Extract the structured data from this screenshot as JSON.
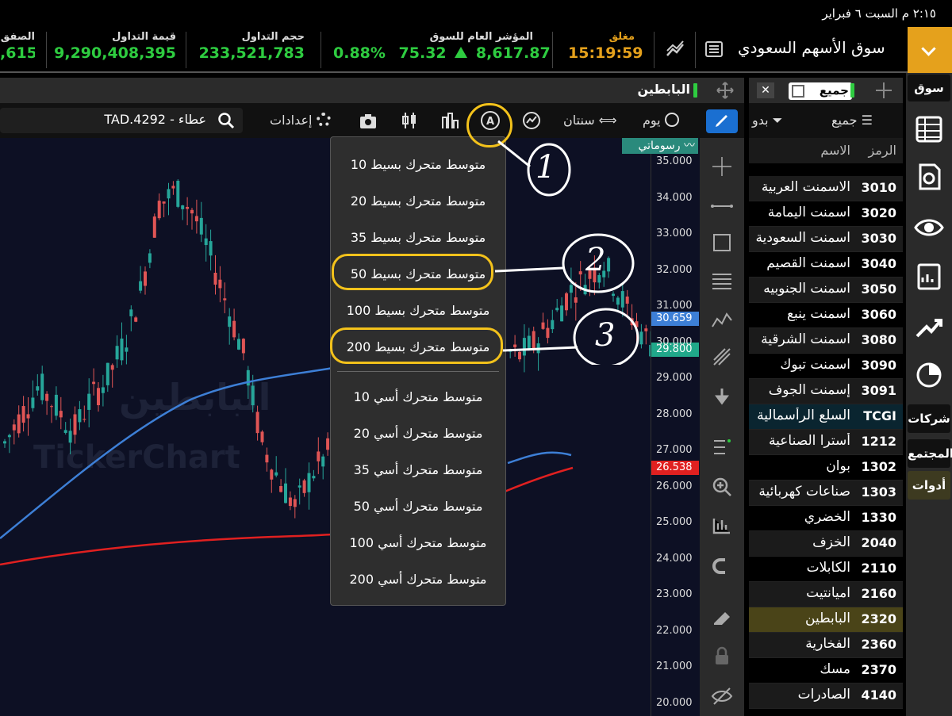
{
  "status_bar": {
    "datetime": "٢:١٥ م   السبت ٦ فبراير"
  },
  "market": {
    "title": "سوق الأسهم السعودي",
    "status_label": "مغلق",
    "status_time": "15:19:59",
    "index_label": "المؤشر العام للسوق",
    "index_value": "8,617.87",
    "index_change": "75.32",
    "index_pct": "0.88%",
    "volume_label": "حجم التداول",
    "volume_value": "233,521,783",
    "turnover_label": "قيمة التداول",
    "turnover_value": "9,290,408,395",
    "deals_label": "الصفق",
    "deals_value": ",615"
  },
  "chart": {
    "title": "البابطين",
    "symbol_search": "TAD.4292 - عطاء",
    "settings_label": "إعدادات",
    "period_label": "سنتان",
    "interval_label": "يوم",
    "drawings_label": "رسوماتي",
    "watermark": "البابطين",
    "watermark2": "TickerChart",
    "price_ticks": [
      "35.000",
      "34.000",
      "33.000",
      "32.000",
      "31.000",
      "30.000",
      "29.000",
      "28.000",
      "27.000",
      "26.000",
      "25.000",
      "24.000",
      "23.000",
      "22.000",
      "21.000",
      "20.000"
    ],
    "tag_ma_blue": "30.659",
    "tag_last": "29.800",
    "tag_ma_red": "26.538"
  },
  "indicator_menu": {
    "items": [
      "متوسط متحرك بسيط 10",
      "متوسط متحرك بسيط 20",
      "متوسط متحرك بسيط 35",
      "متوسط متحرك بسيط 50",
      "متوسط متحرك بسيط 100",
      "متوسط متحرك بسيط 200",
      "متوسط متحرك أسي 10",
      "متوسط متحرك أسي 20",
      "متوسط متحرك أسي 35",
      "متوسط متحرك أسي 50",
      "متوسط متحرك أسي 100",
      "متوسط متحرك أسي 200"
    ]
  },
  "annotations": {
    "one": "1",
    "two": "2",
    "three": "3"
  },
  "watchlist": {
    "title": "جميع",
    "filter_all": "جميع",
    "filter_none": "بدو",
    "col_symbol": "الرمز",
    "col_name": "الاسم",
    "rows": [
      {
        "sym": "3010",
        "name": "الاسمنت العربية"
      },
      {
        "sym": "3020",
        "name": "اسمنت اليمامة"
      },
      {
        "sym": "3030",
        "name": "اسمنت السعودية"
      },
      {
        "sym": "3040",
        "name": "اسمنت القصيم"
      },
      {
        "sym": "3050",
        "name": "اسمنت الجنوبيه"
      },
      {
        "sym": "3060",
        "name": "اسمنت ينبع"
      },
      {
        "sym": "3080",
        "name": "اسمنت الشرقية"
      },
      {
        "sym": "3090",
        "name": "اسمنت تبوك"
      },
      {
        "sym": "3091",
        "name": "إسمنت الجوف"
      },
      {
        "sym": "TCGI",
        "name": "السلع الرأسمالية"
      },
      {
        "sym": "1212",
        "name": "أسترا الصناعية"
      },
      {
        "sym": "1302",
        "name": "بوان"
      },
      {
        "sym": "1303",
        "name": "صناعات كهربائية"
      },
      {
        "sym": "1330",
        "name": "الخضري"
      },
      {
        "sym": "2040",
        "name": "الخزف"
      },
      {
        "sym": "2110",
        "name": "الكابلات"
      },
      {
        "sym": "2160",
        "name": "اميانتيت"
      },
      {
        "sym": "2320",
        "name": "البابطين"
      },
      {
        "sym": "2360",
        "name": "الفخارية"
      },
      {
        "sym": "2370",
        "name": "مسك"
      },
      {
        "sym": "4140",
        "name": "الصادرات"
      }
    ]
  },
  "sidenav": {
    "market": "سوق",
    "companies": "شركات",
    "community": "المجتمع",
    "tools": "أدوات"
  },
  "colors": {
    "accent": "#e5a11c",
    "up": "#2ecc40",
    "ma_blue": "#3d7fd6",
    "ma_red": "#e02020",
    "highlight": "#f3c21b"
  }
}
